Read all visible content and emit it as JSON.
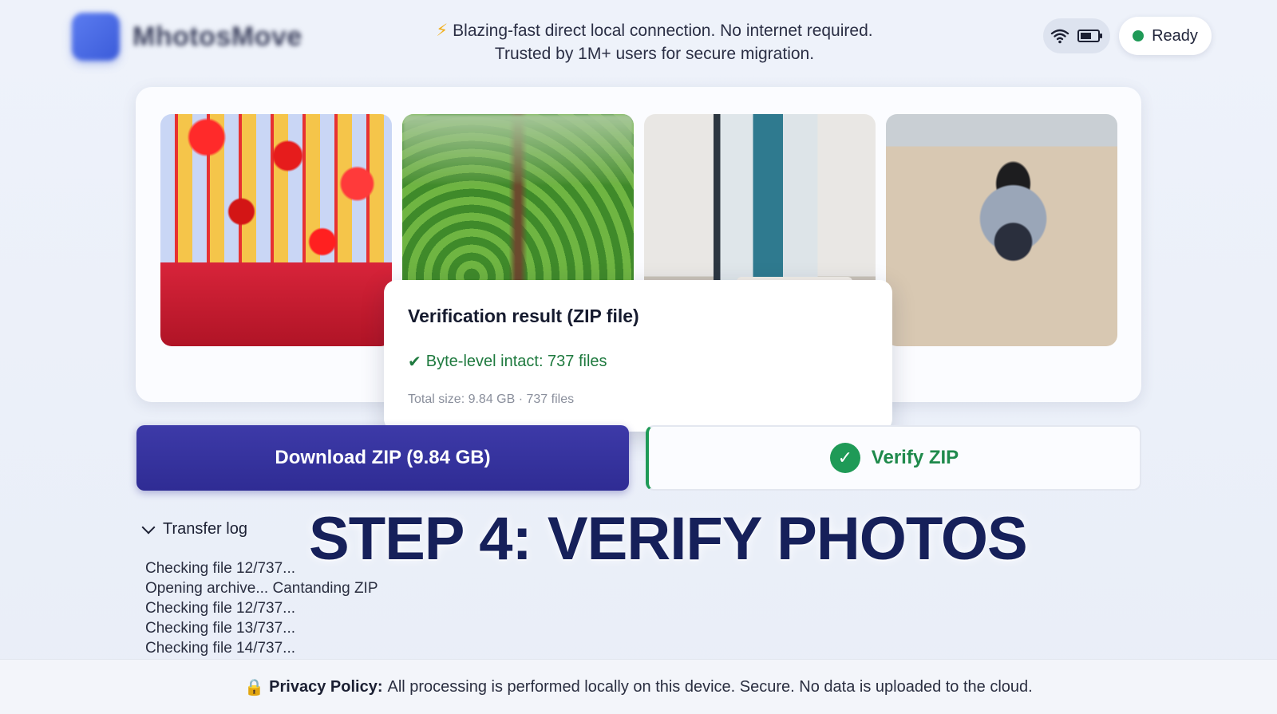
{
  "header": {
    "tagline_line1": "Blazing-fast direct local connection. No internet required.",
    "tagline_line2": "Trusted by 1M+ users for secure migration.",
    "status": "Ready"
  },
  "popup": {
    "title": "Verification result (ZIP file)",
    "status_line": "Byte-level intact: 737 files",
    "meta": "Total size: 9.84 GB · 737 files"
  },
  "actions": {
    "download_label": "Download ZIP (9.84 GB)",
    "verify_label": "Verify ZIP"
  },
  "log": {
    "toggle_label": "Transfer log",
    "lines": [
      "Checking file 12/737...",
      "Opening archive... Cantanding ZIP",
      "Checking file 12/737...",
      "Checking file 13/737...",
      "Checking file 14/737..."
    ]
  },
  "banner": "STEP 4: VERIFY PHOTOS",
  "footer": {
    "label": "Privacy Policy:",
    "text": "All processing is performed locally on this device. Secure. No data is uploaded to the cloud."
  },
  "colors": {
    "primary": "#2f2c94",
    "success": "#1f9a57",
    "banner": "#16205a"
  }
}
